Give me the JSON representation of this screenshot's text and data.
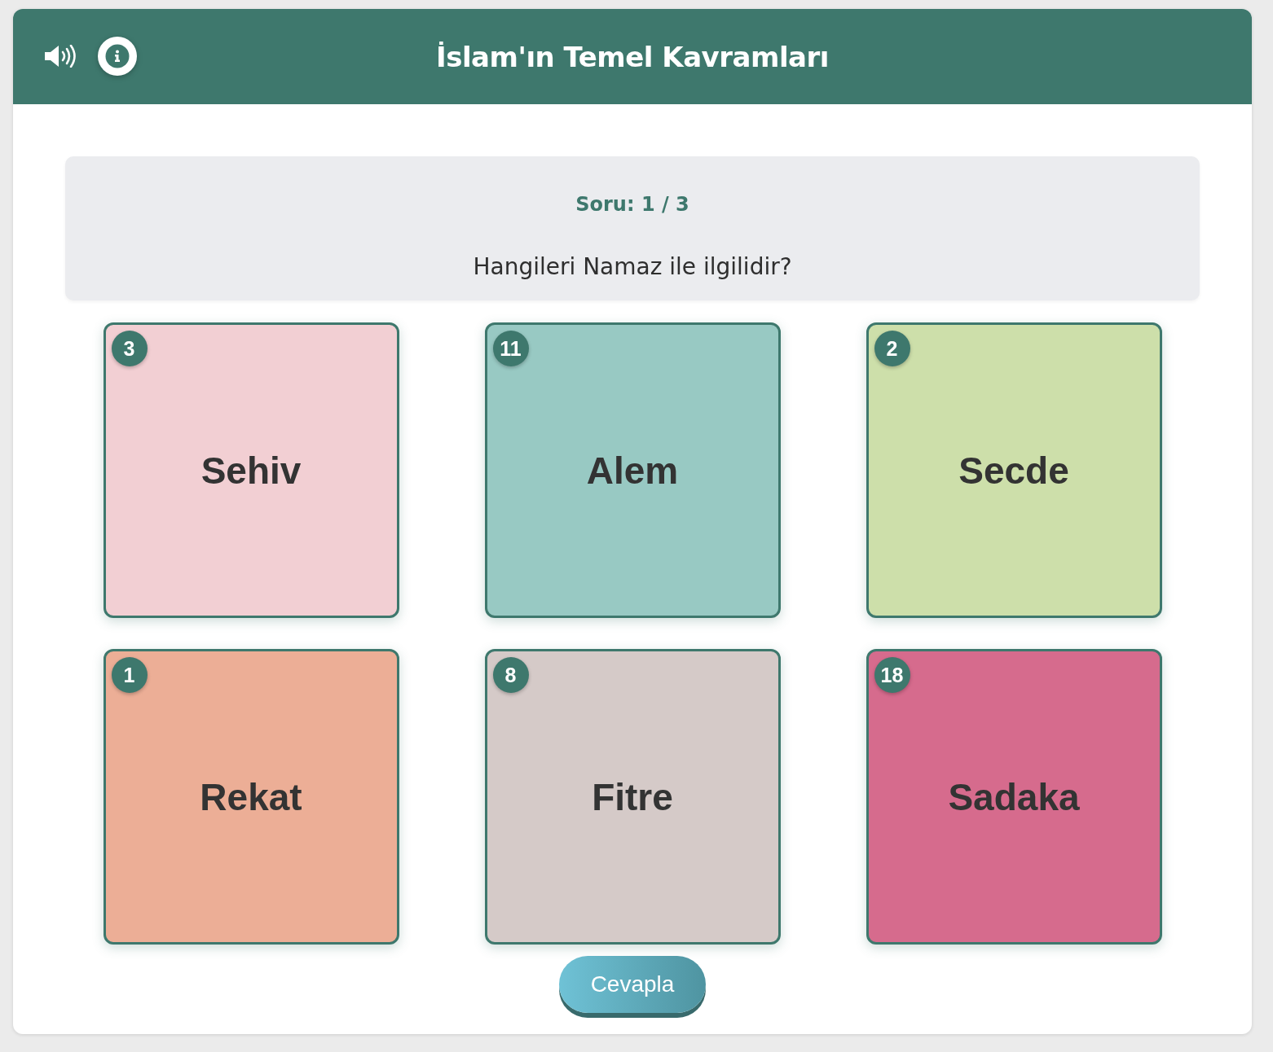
{
  "header": {
    "title": "İslam'ın Temel Kavramları"
  },
  "question": {
    "progress": "Soru: 1 / 3",
    "text": "Hangileri Namaz ile ilgilidir?"
  },
  "tiles": [
    {
      "number": "3",
      "word": "Sehiv",
      "color": "#f2cfd3"
    },
    {
      "number": "11",
      "word": "Alem",
      "color": "#98c9c3"
    },
    {
      "number": "2",
      "word": "Secde",
      "color": "#cddfaa"
    },
    {
      "number": "1",
      "word": "Rekat",
      "color": "#ecae96"
    },
    {
      "number": "8",
      "word": "Fitre",
      "color": "#d5cac8"
    },
    {
      "number": "18",
      "word": "Sadaka",
      "color": "#d66b8d"
    }
  ],
  "answer_button": {
    "label": "Cevapla"
  }
}
